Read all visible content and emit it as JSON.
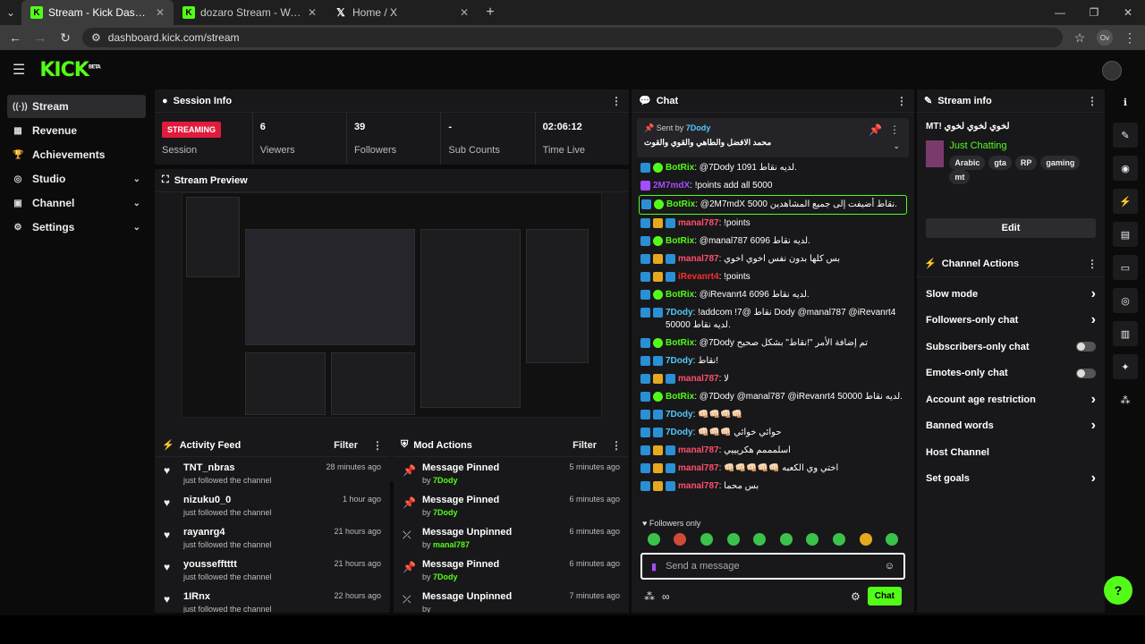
{
  "browser": {
    "tabs": [
      {
        "title": "Stream - Kick Dashboard",
        "icon": "kick-icon",
        "active": true
      },
      {
        "title": "dozaro Stream - Watch Live on",
        "icon": "kick-icon",
        "active": false
      },
      {
        "title": "Home / X",
        "icon": "x-icon",
        "active": false
      }
    ],
    "url": "dashboard.kick.com/stream",
    "profile": "Ov"
  },
  "app": {
    "logo": "KICK",
    "beta": "BETA"
  },
  "sidebar": {
    "items": [
      {
        "label": "Stream",
        "icon": "stream-icon",
        "glyph": "((·))",
        "chev": false
      },
      {
        "label": "Revenue",
        "icon": "revenue-icon",
        "glyph": "▦",
        "chev": false
      },
      {
        "label": "Achievements",
        "icon": "trophy-icon",
        "glyph": "🏆",
        "chev": false
      },
      {
        "label": "Studio",
        "icon": "studio-icon",
        "glyph": "◎",
        "chev": true
      },
      {
        "label": "Channel",
        "icon": "channel-icon",
        "glyph": "▣",
        "chev": true
      },
      {
        "label": "Settings",
        "icon": "gear-icon",
        "glyph": "⚙",
        "chev": true
      }
    ]
  },
  "session": {
    "title": "Session Info",
    "status": "STREAMING",
    "status_label": "Session",
    "stats": [
      {
        "value": "6",
        "label": "Viewers"
      },
      {
        "value": "39",
        "label": "Followers"
      },
      {
        "value": "-",
        "label": "Sub Counts"
      },
      {
        "value": "02:06:12",
        "label": "Time Live"
      }
    ]
  },
  "preview": {
    "title": "Stream Preview"
  },
  "activity": {
    "title": "Activity Feed",
    "filter": "Filter",
    "items": [
      {
        "name": "TNT_nbras",
        "sub": "just followed the channel",
        "time": "28 minutes ago"
      },
      {
        "name": "nizuku0_0",
        "sub": "just followed the channel",
        "time": "1 hour ago"
      },
      {
        "name": "rayanrg4",
        "sub": "just followed the channel",
        "time": "21 hours ago"
      },
      {
        "name": "youssefftttt",
        "sub": "just followed the channel",
        "time": "21 hours ago"
      },
      {
        "name": "1IRnx",
        "sub": "just followed the channel",
        "time": "22 hours ago"
      }
    ]
  },
  "mod": {
    "title": "Mod Actions",
    "filter": "Filter",
    "items": [
      {
        "action": "Message Pinned",
        "by": "by",
        "user": "7Dody",
        "time": "5 minutes ago",
        "icon": "pin-icon"
      },
      {
        "action": "Message Pinned",
        "by": "by",
        "user": "7Dody",
        "time": "6 minutes ago",
        "icon": "pin-icon"
      },
      {
        "action": "Message Unpinned",
        "by": "by",
        "user": "manal787",
        "time": "6 minutes ago",
        "icon": "unpin-icon"
      },
      {
        "action": "Message Pinned",
        "by": "by",
        "user": "7Dody",
        "time": "6 minutes ago",
        "icon": "pin-icon"
      },
      {
        "action": "Message Unpinned",
        "by": "by",
        "user": "",
        "time": "7 minutes ago",
        "icon": "unpin-icon"
      }
    ]
  },
  "chat": {
    "title": "Chat",
    "pinned": {
      "sent_by": "Sent by",
      "user": "7Dody",
      "message": "محمد الافضل والطاهي والقوي والقوت"
    },
    "messages": [
      {
        "user": "BotRix",
        "color": "#53fc18",
        "badges": [
          "blue",
          "green"
        ],
        "text": "@7Dody 1091 لديه نقاط.",
        "hl": false
      },
      {
        "user": "2M7mdX",
        "color": "#a44dff",
        "badges": [
          "purple"
        ],
        "text": "!points add all 5000",
        "hl": false
      },
      {
        "user": "BotRix",
        "color": "#53fc18",
        "badges": [
          "blue",
          "green"
        ],
        "text": "@2M7mdX 5000 نقاط أضيفت إلى جميع المشاهدين.",
        "hl": true
      },
      {
        "user": "manal787",
        "color": "#ff4f6d",
        "badges": [
          "blue",
          "gold",
          "blue"
        ],
        "text": "!points",
        "hl": false
      },
      {
        "user": "BotRix",
        "color": "#53fc18",
        "badges": [
          "blue",
          "green"
        ],
        "text": "@manal787 6096 لديه نقاط.",
        "hl": false
      },
      {
        "user": "manal787",
        "color": "#ff4f6d",
        "badges": [
          "blue",
          "gold",
          "blue"
        ],
        "text": "بس كلها بدون نفس اخوي اخوي",
        "hl": false
      },
      {
        "user": "iRevanrt4",
        "color": "#ff2b2b",
        "badges": [
          "blue",
          "gold",
          "blue"
        ],
        "text": "!points",
        "hl": false
      },
      {
        "user": "BotRix",
        "color": "#53fc18",
        "badges": [
          "blue",
          "green"
        ],
        "text": "@iRevanrt4 6096 لديه نقاط.",
        "hl": false
      },
      {
        "user": "7Dody",
        "color": "#53c8fc",
        "badges": [
          "blue",
          "blue"
        ],
        "text": "!addcom !7@ نقاط Dody @manal787 @iRevanrt4 لديه نقاط 50000.",
        "hl": false
      },
      {
        "user": "BotRix",
        "color": "#53fc18",
        "badges": [
          "blue",
          "green"
        ],
        "text": "@7Dody تم إضافة الأمر \"!نقاط\" بشكل صحيح",
        "hl": false
      },
      {
        "user": "7Dody",
        "color": "#53c8fc",
        "badges": [
          "blue",
          "blue"
        ],
        "text": "نقاط!",
        "hl": false
      },
      {
        "user": "manal787",
        "color": "#ff4f6d",
        "badges": [
          "blue",
          "gold",
          "blue"
        ],
        "text": "لا",
        "hl": false
      },
      {
        "user": "BotRix",
        "color": "#53fc18",
        "badges": [
          "blue",
          "green"
        ],
        "text": "@7Dody @manal787 @iRevanrt4 50000 لديه نقاط.",
        "hl": false
      },
      {
        "user": "7Dody",
        "color": "#53c8fc",
        "badges": [
          "blue",
          "blue"
        ],
        "text": "👊🏻👊🏻👊🏻👊🏻",
        "hl": false
      },
      {
        "user": "7Dody",
        "color": "#53c8fc",
        "badges": [
          "blue",
          "blue"
        ],
        "text": "👊🏻👊🏻👊🏻 حوائي خوائي",
        "hl": false
      },
      {
        "user": "manal787",
        "color": "#ff4f6d",
        "badges": [
          "blue",
          "gold",
          "blue"
        ],
        "text": "اسلمممم هكريييي",
        "hl": false
      },
      {
        "user": "manal787",
        "color": "#ff4f6d",
        "badges": [
          "blue",
          "gold",
          "blue"
        ],
        "text": "👊🏻👊🏻👊🏻👊🏻👊🏻 اختي وي الكعبه",
        "hl": false
      },
      {
        "user": "manal787",
        "color": "#ff4f6d",
        "badges": [
          "blue",
          "gold",
          "blue"
        ],
        "text": "بس محما",
        "hl": false
      }
    ],
    "followers_only": "Followers only",
    "placeholder": "Send a message",
    "send": "Chat"
  },
  "streaminfo": {
    "title": "Stream info",
    "stream_title": "MT! لخوي لخوي لخوي",
    "category": "Just Chatting",
    "tags": [
      "Arabic",
      "gta",
      "RP",
      "gaming",
      "mt"
    ],
    "edit": "Edit"
  },
  "actions": {
    "title": "Channel Actions",
    "items": [
      {
        "label": "Slow mode",
        "control": "chevron"
      },
      {
        "label": "Followers-only chat",
        "control": "chevron"
      },
      {
        "label": "Subscribers-only chat",
        "control": "toggle"
      },
      {
        "label": "Emotes-only chat",
        "control": "toggle"
      },
      {
        "label": "Account age restriction",
        "control": "chevron"
      },
      {
        "label": "Banned words",
        "control": "chevron"
      },
      {
        "label": "Host Channel",
        "control": "none"
      },
      {
        "label": "Set goals",
        "control": "chevron"
      }
    ]
  },
  "colors": {
    "brand": "#53fc18",
    "live": "#e01b3c",
    "panel": "#18181a"
  }
}
